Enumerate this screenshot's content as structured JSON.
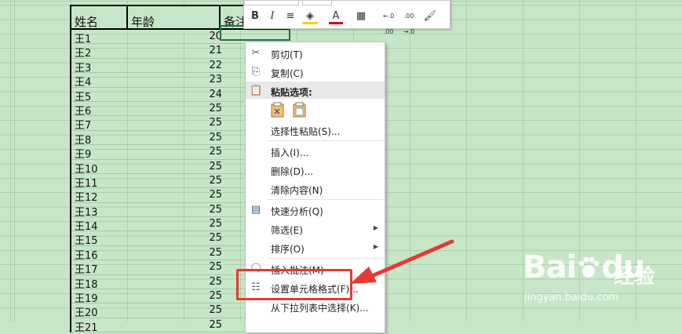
{
  "sheet": {
    "headers": {
      "name": "姓名",
      "age": "年龄",
      "note": "备注"
    },
    "rows": [
      {
        "name": "王1",
        "age": "20"
      },
      {
        "name": "王2",
        "age": "21"
      },
      {
        "name": "王3",
        "age": "22"
      },
      {
        "name": "王4",
        "age": "23"
      },
      {
        "name": "王5",
        "age": "24"
      },
      {
        "name": "王6",
        "age": "25"
      },
      {
        "name": "王7",
        "age": "25"
      },
      {
        "name": "王8",
        "age": "25"
      },
      {
        "name": "王9",
        "age": "25"
      },
      {
        "name": "王10",
        "age": "25"
      },
      {
        "name": "王11",
        "age": "25"
      },
      {
        "name": "王12",
        "age": "25"
      },
      {
        "name": "王13",
        "age": "25"
      },
      {
        "name": "王14",
        "age": "25"
      },
      {
        "name": "王15",
        "age": "25"
      },
      {
        "name": "王16",
        "age": "25"
      },
      {
        "name": "王17",
        "age": "25"
      },
      {
        "name": "王18",
        "age": "25"
      },
      {
        "name": "王19",
        "age": "25"
      },
      {
        "name": "王20",
        "age": "25"
      },
      {
        "name": "王21",
        "age": "25"
      }
    ]
  },
  "mini_toolbar": {
    "bold": "B",
    "italic": "I",
    "align": "≡",
    "fill": "◈",
    "font_color": "A",
    "border": "▦",
    "inc_decimal": "←.0 .00",
    "dec_decimal": ".00 →.0",
    "format_painter": "🖌"
  },
  "context_menu": {
    "cut": "剪切(T)",
    "copy": "复制(C)",
    "paste_options": "粘贴选项:",
    "paste_special": "选择性粘贴(S)...",
    "insert": "插入(I)...",
    "delete": "删除(D)...",
    "clear": "清除内容(N)",
    "quick_analysis": "快速分析(Q)",
    "filter": "筛选(E)",
    "sort": "排序(O)",
    "insert_comment": "插入批注(M)",
    "format_cells": "设置单元格格式(F)...",
    "pick_list": "从下拉列表中选择(K)..."
  },
  "watermark": {
    "brand": "Bai",
    "brand2": "du",
    "cn": "经验",
    "url": "jingyan.baidu.com"
  },
  "colors": {
    "sheet_bg": "#c7e6c7",
    "highlight": "#e53935",
    "selection": "#217346"
  }
}
